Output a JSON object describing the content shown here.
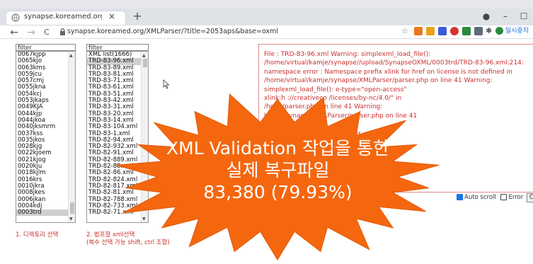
{
  "browser": {
    "tab_title": "synapse.koreamed.org/x",
    "tab_close": "×",
    "new_tab": "+",
    "address": "synapse.koreamed.org/XMLParser/?title=2053aps&base=oxml",
    "profile_label": "일시중지",
    "win_minimize": "–",
    "win_record": "●",
    "win_max": "☐",
    "nav_back": "←",
    "nav_forward": "→",
    "nav_reload": "C"
  },
  "directory_panel": {
    "filter_value": "filter",
    "items": [
      "0067kjpp",
      "0065kjo",
      "0063kms",
      "0059jcu",
      "0057cmj",
      "0055jkna",
      "0054kcj",
      "0053jkaps",
      "0049KJA",
      "0044kjp",
      "0044jkoa",
      "0040jksmrm",
      "0037kss",
      "0035jkos",
      "0028kjg",
      "0022kjoem",
      "0021kjog",
      "0020kju",
      "0018kjlm",
      "0016krs",
      "0010jkra",
      "0008jkes",
      "0006jkan",
      "0004kdj",
      "0003trd"
    ],
    "selected_index": 24,
    "caption": "1. 디렉토리 선택"
  },
  "xml_panel": {
    "filter_value": "filter",
    "items": [
      "XML list(1666)",
      "TRD-83-96.xml",
      "TRD-83-89.xml",
      "TRD-83-81.xml",
      "TRD-83-71.xml",
      "TRD-83-61.xml",
      "TRD-83-51.xml",
      "TRD-83-42.xml",
      "TRD-83-31.xml",
      "TRD-83-20.xml",
      "TRD-83-14.xml",
      "TRD-83-104.xml",
      "TRD-83-1.xml",
      "TRD-82-94.xml",
      "TRD-82-932.xml",
      "TRD-82-91.xml",
      "TRD-82-889.xml",
      "TRD-82-88.xml",
      "TRD-82-86.xml",
      "TRD-82-824.xml",
      "TRD-82-817.xml",
      "TRD-82-81.xml",
      "TRD-82-788.xml",
      "TRD-82-733.xml",
      "TRD-82-71.xml"
    ],
    "selected_index": 1,
    "caption_line1": "2. 법프할 xml선택",
    "caption_line2": "(복수 선택 가능 shift, ctrl 조합)"
  },
  "error_log": {
    "text": "File : TRD-83-96.xml Warning: simplexml_load_file():\n/home/virtual/kamje/synapse//upload/SynapseOXML/0003trd/TRD-83-96.xml:214:\nnamespace error : Namespace prefix xlink for href on license is not defined in\n/home/virtual/kamje/synapse/XMLParser/parser.php on line 41 Warning:\nsimplexml_load_file(): e-type=\"open-access\"\nxlink:h                    ://creativeco              /licenses/by-nc/4.0/\" in\n/hom                                                     /parser.php on line 41 Warning:\n                                                     kamje/synapse/XMLParser/parser.php on line 41\n\n                                                              d/TRD-83-96.xml:1171: parser\n\n                                                              41 Warning:\n\n                                                              XMLParser/parser.php\n\n                                                              Warning:\n                                                              SynapseOXML/0003trd/TRD-\n                                                              t the start of the document\n                                                              41 Warning:"
  },
  "controls": {
    "auto_scroll_label": "Auto scroll",
    "auto_scroll_checked": true,
    "error_label": "Error",
    "error_checked": false,
    "clear_label": "Cle"
  },
  "overlay": {
    "line1": "XML Validation 작업을 통한",
    "line2": "실제 복구파일",
    "line3": "83,380 (79.93%)",
    "burst_color": "#f4670f"
  }
}
